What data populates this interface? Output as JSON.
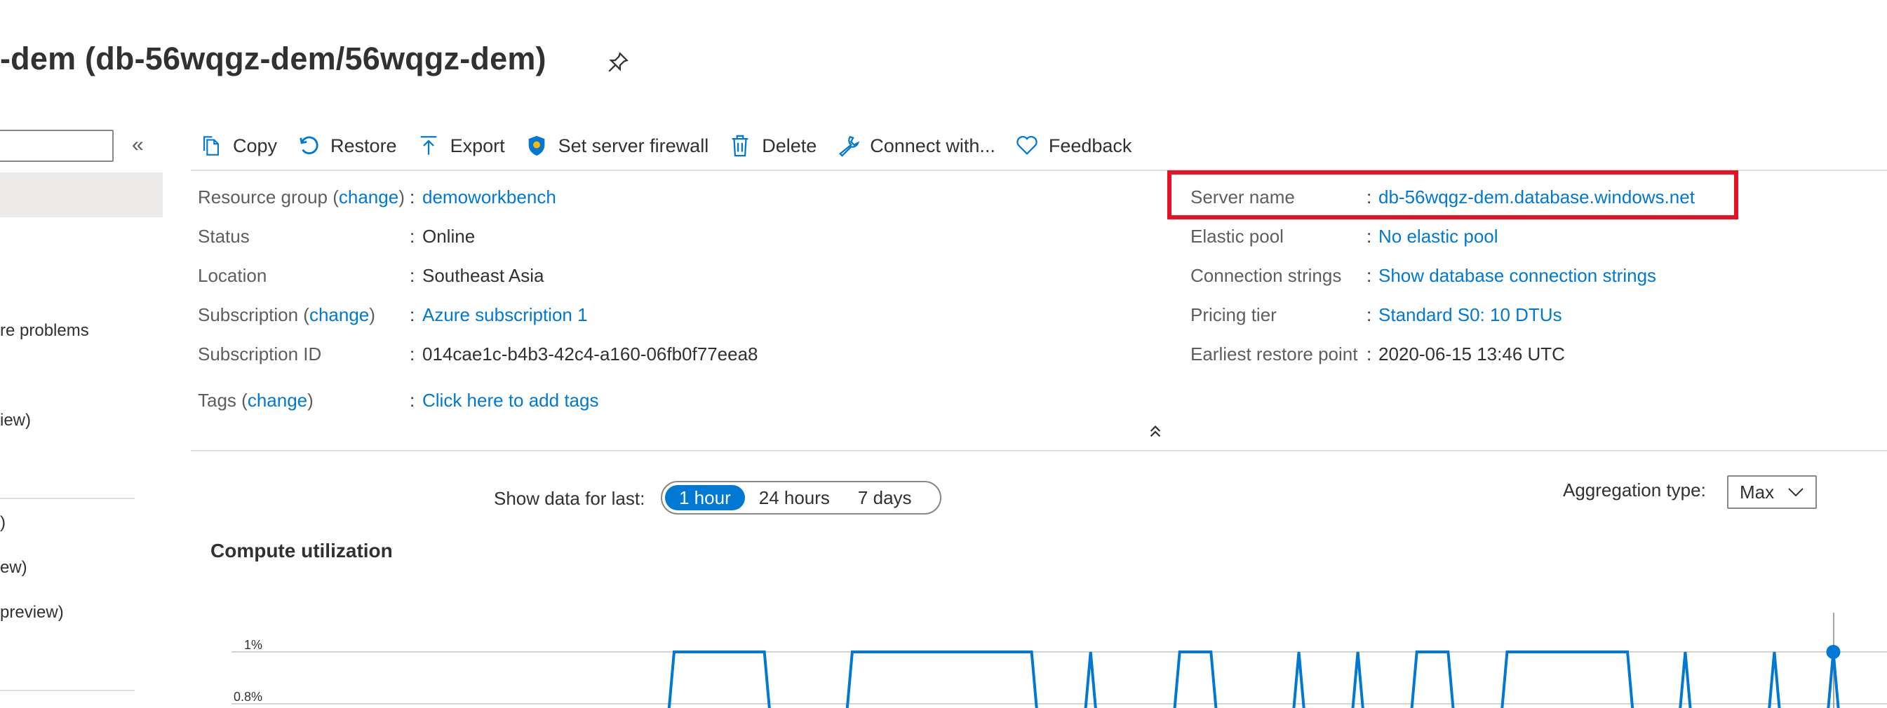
{
  "header": {
    "title": "-dem (db-56wqgz-dem/56wqgz-dem)"
  },
  "nav": {
    "items": [
      "re problems",
      "iew)",
      ")",
      "ew)",
      "preview)"
    ]
  },
  "toolbar": {
    "copy": "Copy",
    "restore": "Restore",
    "export": "Export",
    "firewall": "Set server firewall",
    "delete": "Delete",
    "connect": "Connect with...",
    "feedback": "Feedback"
  },
  "essentials": {
    "resource_group_label": "Resource group",
    "resource_group_value": "demoworkbench",
    "status_label": "Status",
    "status_value": "Online",
    "location_label": "Location",
    "location_value": "Southeast Asia",
    "subscription_label": "Subscription",
    "subscription_value": "Azure subscription 1",
    "subscription_id_label": "Subscription ID",
    "subscription_id_value": "014cae1c-b4b3-42c4-a160-06fb0f77eea8",
    "tags_label": "Tags",
    "tags_value": "Click here to add tags",
    "change": "change",
    "server_name_label": "Server name",
    "server_name_value": "db-56wqgz-dem.database.windows.net",
    "elastic_pool_label": "Elastic pool",
    "elastic_pool_value": "No elastic pool",
    "connection_strings_label": "Connection strings",
    "connection_strings_value": "Show database connection strings",
    "pricing_tier_label": "Pricing tier",
    "pricing_tier_value": "Standard S0: 10 DTUs",
    "restore_point_label": "Earliest restore point",
    "restore_point_value": "2020-06-15 13:46 UTC"
  },
  "controls": {
    "show_label": "Show data for last:",
    "ranges": [
      "1 hour",
      "24 hours",
      "7 days"
    ],
    "selected_range": "1 hour",
    "agg_label": "Aggregation type:",
    "agg_value": "Max"
  },
  "chart_title": "Compute utilization",
  "chart_data": {
    "type": "line",
    "title": "Compute utilization",
    "y_ticks": [
      "1%",
      "0.8%"
    ],
    "color": "#0078d4",
    "series": [
      {
        "segments_at_max": [
          [
            560,
            635
          ],
          [
            708,
            857
          ],
          [
            906,
            906
          ],
          [
            980,
            1006
          ],
          [
            1079,
            1079
          ],
          [
            1128,
            1128
          ],
          [
            1177,
            1203
          ],
          [
            1252,
            1352
          ],
          [
            1400,
            1400
          ],
          [
            1474,
            1474
          ],
          [
            1523,
            1523
          ]
        ]
      }
    ]
  }
}
